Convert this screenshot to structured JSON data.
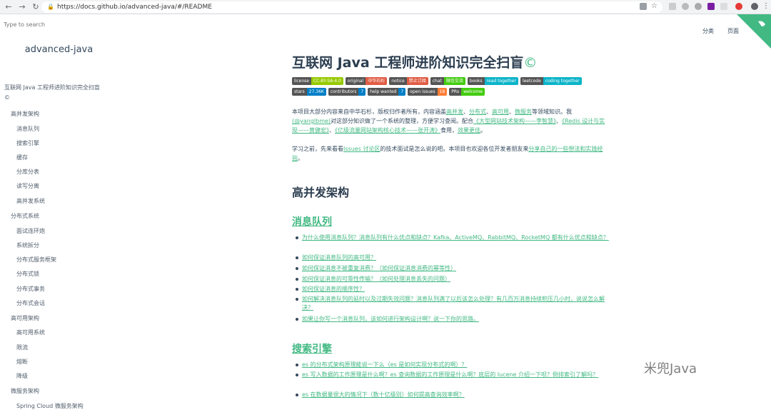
{
  "browser": {
    "url": "https://docs.github.io/advanced-java/#/README"
  },
  "sidebar": {
    "search_placeholder": "Type to search",
    "app_name": "advanced-java",
    "items": [
      "互联网 Java 工程师进阶知识完全扫盲",
      "©",
      "高并发架构",
      "消息队列",
      "搜索引擎",
      "缓存",
      "分库分表",
      "读写分离",
      "高并发系统",
      "分布式系统",
      "面试连环炮",
      "系统拆分",
      "分布式服务框架",
      "分布式锁",
      "分布式事务",
      "分布式会话",
      "高可用架构",
      "高可用系统",
      "限流",
      "熔断",
      "降级",
      "微服务架构",
      "Spring Cloud 微服务架构"
    ]
  },
  "topnav": {
    "categories": "分类",
    "pages": "页面"
  },
  "main": {
    "title": "互联网 Java 工程师进阶知识完全扫盲",
    "title_symbol": "©",
    "badges_row1": [
      {
        "left": "license",
        "right": "CC-BY-SA-4.0",
        "color": "#97ca00"
      },
      {
        "left": "original",
        "right": "中华石杉",
        "color": "#e05d44"
      },
      {
        "left": "notice",
        "right": "禁止订阅",
        "color": "#e05d44"
      },
      {
        "left": "chat",
        "right": "微信交流",
        "color": "#4c1"
      },
      {
        "left": "books",
        "right": "read together",
        "color": "#0cb4c9"
      },
      {
        "left": "leetcode",
        "right": "coding together",
        "color": "#0cb4c9"
      }
    ],
    "badges_row2": [
      {
        "left": "stars",
        "right": "27.36K",
        "color": "#007ec6"
      },
      {
        "left": "contributors",
        "right": "7",
        "color": "#007ec6"
      },
      {
        "left": "help wanted",
        "right": "7",
        "color": "#007ec6"
      },
      {
        "left": "open issues",
        "right": "18",
        "color": "#fe7d37"
      },
      {
        "left": "PRs",
        "right": "welcome",
        "color": "#4c1"
      }
    ],
    "intro_p1_a": "本项目大部分内容来自中华石杉，版权归作者所有，内容涵盖",
    "intro_p1_links": [
      "高并发",
      "分布式",
      "高可用",
      "微服务"
    ],
    "intro_p1_b": "等领域知识。我",
    "intro_p1_user": "(@yanglbme)",
    "intro_p1_c": "对这部分知识做了一个系统的整理，方便学习查阅。配合",
    "intro_p1_book1": "《大型网站技术架构——李智慧》",
    "intro_p1_d": "、",
    "intro_p1_book2": "《Redis 设计与实现——黄健宏》",
    "intro_p1_e": "、",
    "intro_p1_book3": "《亿级流量网站架构核心技术——张开涛》",
    "intro_p1_f": "食用，",
    "intro_p1_g": "效果更佳",
    "intro_p1_h": "。",
    "intro_p2_a": "学习之前，先来看看",
    "intro_p2_link": "Issues 讨论区",
    "intro_p2_b": "的技术面试是怎么说的吧。本项目也欢迎各位开发者朋友来",
    "intro_p2_link2": "分享自己的一些想法和实践经验",
    "intro_p2_c": "。",
    "h2": "高并发架构",
    "section_mq": "消息队列",
    "mq_items": [
      "为什么使用消息队列？消息队列有什么优点和缺点？Kafka、ActiveMQ、RabbitMQ、RocketMQ 都有什么优点和缺点？",
      "如何保证消息队列的高可用？",
      "如何保证消息不被重复消费？（如何保证消息消费的幂等性）",
      "如何保证消息的可靠性传输？（如何处理消息丢失的问题）",
      "如何保证消息的顺序性？",
      "如何解决消息队列的延时以及过期失效问题？消息队列满了以后该怎么处理？有几百万消息持续积压几小时，说说怎么解决？",
      "如果让你写一个消息队列，该如何进行架构设计啊？说一下你的思路。"
    ],
    "section_search": "搜索引擎",
    "search_items": [
      "es 的分布式架构原理能说一下么（es 是如何实现分布式的啊）？",
      "es 写入数据的工作原理是什么啊？es 查询数据的工作原理是什么啊？底层的 lucene 介绍一下呗？倒排索引了解吗？",
      "es 在数据量很大的情况下（数十亿级别）如何提高查询效率啊？"
    ]
  },
  "watermark": "米兜Java"
}
